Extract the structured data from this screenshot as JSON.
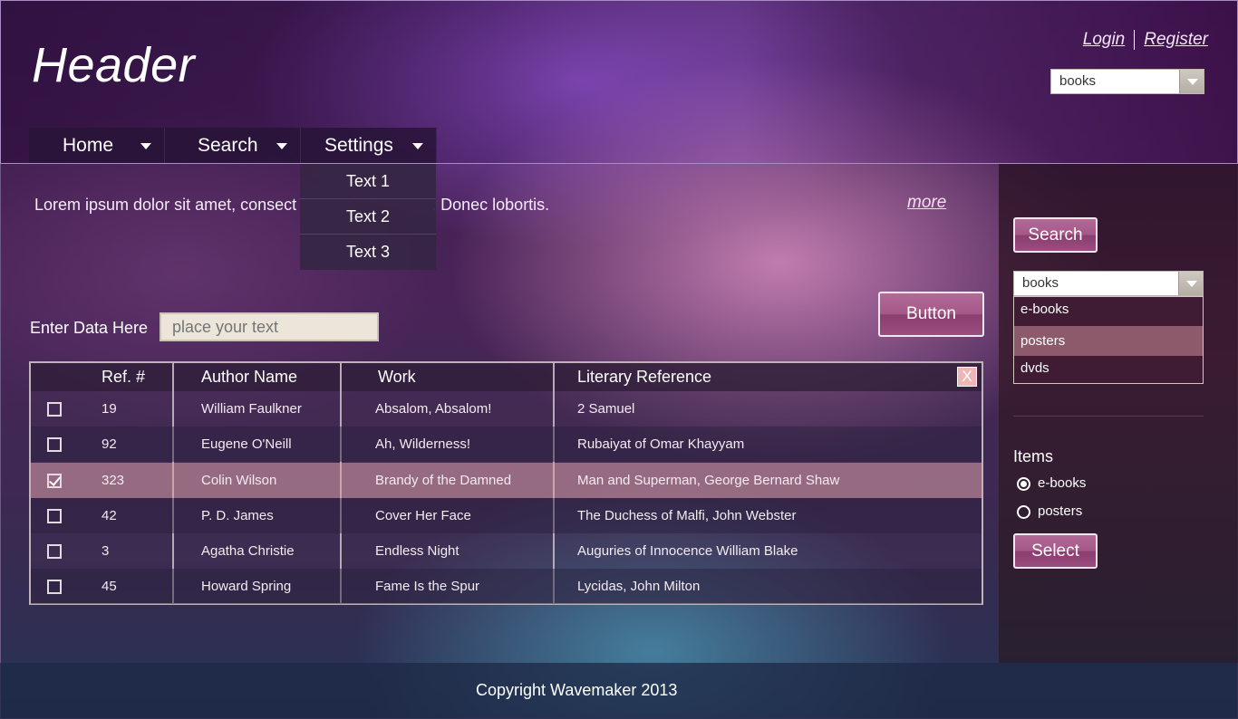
{
  "header": {
    "title": "Header",
    "login": "Login",
    "register": "Register",
    "category_select": "books"
  },
  "nav": {
    "items": [
      {
        "label": "Home"
      },
      {
        "label": "Search"
      },
      {
        "label": "Settings"
      }
    ],
    "dropdown": [
      "Text 1",
      "Text 2",
      "Text 3"
    ]
  },
  "main": {
    "intro_text": "Lorem ipsum dolor sit amet, consect",
    "intro_text_tail": ". Donec lobortis.",
    "more_link": "more",
    "form_label": "Enter Data Here",
    "form_placeholder": "place your text",
    "button_label": "Button"
  },
  "table": {
    "headers": [
      "Ref. #",
      "Author Name",
      "Work",
      "Literary Reference"
    ],
    "close_icon": "X",
    "rows": [
      {
        "checked": false,
        "ref": "19",
        "author": "William Faulkner",
        "work": "Absalom, Absalom!",
        "reference": "2 Samuel"
      },
      {
        "checked": false,
        "ref": "92",
        "author": "Eugene O'Neill",
        "work": "Ah, Wilderness!",
        "reference": "Rubaiyat of Omar Khayyam"
      },
      {
        "checked": true,
        "ref": "323",
        "author": "Colin Wilson",
        "work": "Brandy of the Damned",
        "reference": "Man and Superman, George Bernard Shaw"
      },
      {
        "checked": false,
        "ref": "42",
        "author": "P. D. James",
        "work": "Cover Her Face",
        "reference": "The Duchess of Malfi, John Webster"
      },
      {
        "checked": false,
        "ref": "3",
        "author": "Agatha Christie",
        "work": "Endless Night",
        "reference": "Auguries of Innocence William Blake"
      },
      {
        "checked": false,
        "ref": "45",
        "author": "Howard Spring",
        "work": "Fame Is the Spur",
        "reference": "Lycidas, John Milton"
      }
    ]
  },
  "sidebar": {
    "search_button": "Search",
    "select_value": "books",
    "options": [
      "e-books",
      "posters",
      "dvds"
    ],
    "highlighted_option": "posters",
    "items_label": "Items",
    "radios": [
      {
        "label": "e-books",
        "checked": true
      },
      {
        "label": "posters",
        "checked": false
      }
    ],
    "select_button": "Select"
  },
  "footer": {
    "copyright": "Copyright Wavemaker 2013"
  },
  "colors": {
    "button_accent": "#a45888",
    "selected_row": "#dca0aa",
    "footer_bg": "#1e2846"
  }
}
